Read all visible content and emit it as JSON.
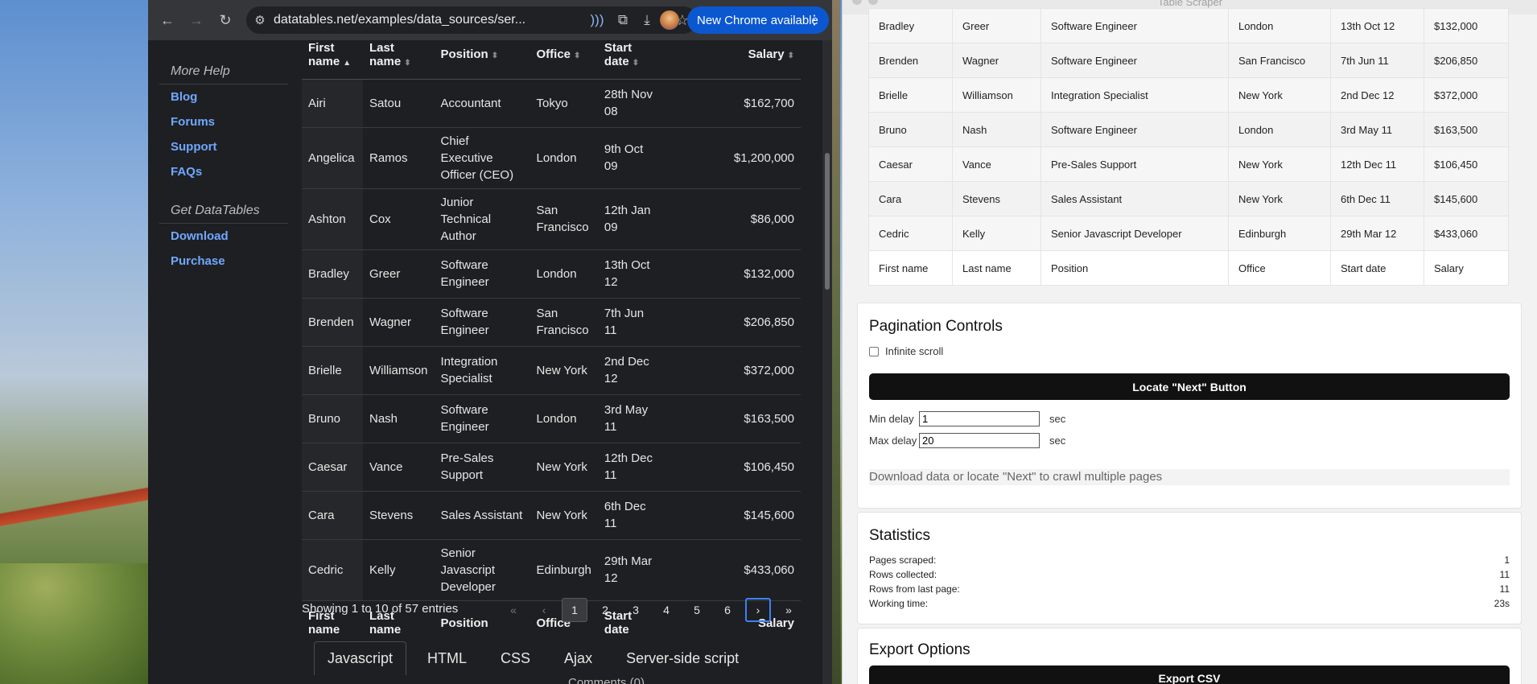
{
  "browser": {
    "url": "datatables.net/examples/data_sources/ser...",
    "update_button": "New Chrome available"
  },
  "page": {
    "sidebar": {
      "heading_more_help": "More Help",
      "help_links": [
        "Blog",
        "Forums",
        "Support",
        "FAQs"
      ],
      "heading_get": "Get DataTables",
      "get_links": [
        "Download",
        "Purchase"
      ]
    },
    "table": {
      "header_top": [
        "First name",
        "Last name",
        "Position",
        "Office",
        "Start date",
        "Salary"
      ],
      "footer": [
        "First name",
        "Last name",
        "Position",
        "Office",
        "Start date",
        "Salary"
      ],
      "rows": [
        [
          "Airi",
          "Satou",
          "Accountant",
          "Tokyo",
          "28th Nov 08",
          "$162,700"
        ],
        [
          "Angelica",
          "Ramos",
          "Chief Executive Officer (CEO)",
          "London",
          "9th Oct 09",
          "$1,200,000"
        ],
        [
          "Ashton",
          "Cox",
          "Junior Technical Author",
          "San Francisco",
          "12th Jan 09",
          "$86,000"
        ],
        [
          "Bradley",
          "Greer",
          "Software Engineer",
          "London",
          "13th Oct 12",
          "$132,000"
        ],
        [
          "Brenden",
          "Wagner",
          "Software Engineer",
          "San Francisco",
          "7th Jun 11",
          "$206,850"
        ],
        [
          "Brielle",
          "Williamson",
          "Integration Specialist",
          "New York",
          "2nd Dec 12",
          "$372,000"
        ],
        [
          "Bruno",
          "Nash",
          "Software Engineer",
          "London",
          "3rd May 11",
          "$163,500"
        ],
        [
          "Caesar",
          "Vance",
          "Pre-Sales Support",
          "New York",
          "12th Dec 11",
          "$106,450"
        ],
        [
          "Cara",
          "Stevens",
          "Sales Assistant",
          "New York",
          "6th Dec 11",
          "$145,600"
        ],
        [
          "Cedric",
          "Kelly",
          "Senior Javascript Developer",
          "Edinburgh",
          "29th Mar 12",
          "$433,060"
        ]
      ],
      "info": "Showing 1 to 10 of 57 entries",
      "pager": {
        "first": "«",
        "prev": "‹",
        "pages": [
          "1",
          "2",
          "3",
          "4",
          "5",
          "6"
        ],
        "next": "›",
        "last": "»"
      }
    },
    "tabs": [
      "Javascript",
      "HTML",
      "CSS",
      "Ajax",
      "Server-side script"
    ],
    "comments_label": "Comments (0)"
  },
  "scraper": {
    "title": "Table Scraper",
    "table_rows": [
      [
        "Bradley",
        "Greer",
        "Software Engineer",
        "London",
        "13th Oct 12",
        "$132,000"
      ],
      [
        "Brenden",
        "Wagner",
        "Software Engineer",
        "San Francisco",
        "7th Jun 11",
        "$206,850"
      ],
      [
        "Brielle",
        "Williamson",
        "Integration Specialist",
        "New York",
        "2nd Dec 12",
        "$372,000"
      ],
      [
        "Bruno",
        "Nash",
        "Software Engineer",
        "London",
        "3rd May 11",
        "$163,500"
      ],
      [
        "Caesar",
        "Vance",
        "Pre-Sales Support",
        "New York",
        "12th Dec 11",
        "$106,450"
      ],
      [
        "Cara",
        "Stevens",
        "Sales Assistant",
        "New York",
        "6th Dec 11",
        "$145,600"
      ],
      [
        "Cedric",
        "Kelly",
        "Senior Javascript Developer",
        "Edinburgh",
        "29th Mar 12",
        "$433,060"
      ],
      [
        "First name",
        "Last name",
        "Position",
        "Office",
        "Start date",
        "Salary"
      ]
    ],
    "pagination": {
      "heading": "Pagination Controls",
      "infinite_scroll_label": "Infinite scroll",
      "locate_next_button": "Locate \"Next\" Button",
      "min_delay_label": "Min delay",
      "min_delay_value": "1",
      "max_delay_label": "Max delay",
      "max_delay_value": "20",
      "unit": "sec",
      "status": "Download data or locate \"Next\" to crawl multiple pages"
    },
    "statistics": {
      "heading": "Statistics",
      "rows": [
        {
          "label": "Pages scraped:",
          "value": "1"
        },
        {
          "label": "Rows collected:",
          "value": "11"
        },
        {
          "label": "Rows from last page:",
          "value": "11"
        },
        {
          "label": "Working time:",
          "value": "23s"
        }
      ]
    },
    "export": {
      "heading": "Export Options",
      "csv_button": "Export CSV"
    }
  }
}
